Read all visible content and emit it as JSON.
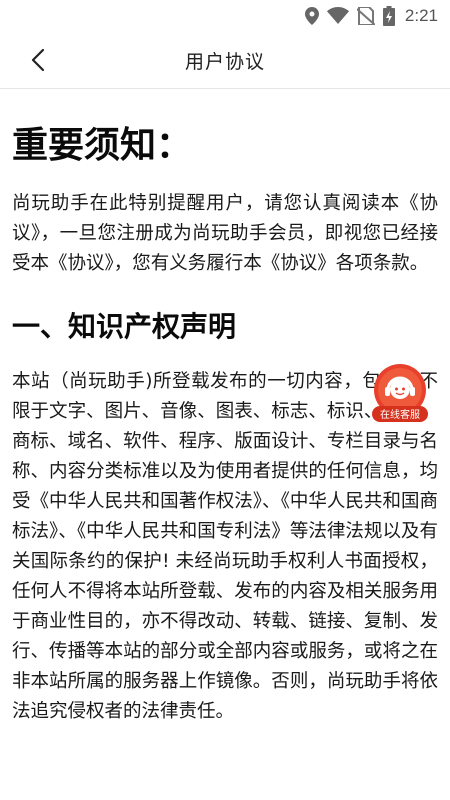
{
  "status_bar": {
    "time": "2:21",
    "icons": [
      "location-icon",
      "wifi-icon",
      "no-sim-icon",
      "battery-charging-icon"
    ]
  },
  "header": {
    "title": "用户协议",
    "back_icon": "chevron-left-icon"
  },
  "content": {
    "heading_main": "重要须知：",
    "intro": "尚玩助手在此特别提醒用户，请您认真阅读本《协议》，一旦您注册成为尚玩助手会员，即视您已经接受本《协议》，您有义务履行本《协议》各项条款。",
    "section_title": "一、知识产权声明",
    "section_body": "本站（尚玩助手)所登载发布的一切内容，包括但不限于文字、图片、音像、图表、标志、标识、广告、商标、域名、软件、程序、版面设计、专栏目录与名称、内容分类标准以及为使用者提供的任何信息，均受《中华人民共和国著作权法》、《中华人民共和国商标法》、《中华人民共和国专利法》等法律法规以及有关国际条约的保护! 未经尚玩助手权利人书面授权，任何人不得将本站所登载、发布的内容及相关服务用于商业性目的，亦不得改动、转载、链接、复制、发行、传播等本站的部分或全部内容或服务，或将之在非本站所属的服务器上作镜像。否则，尚玩助手将依法追究侵权者的法律责任。"
  },
  "floating_service": {
    "label": "在线客服",
    "icon": "customer-service-headset-icon",
    "color": "#e8402a"
  }
}
